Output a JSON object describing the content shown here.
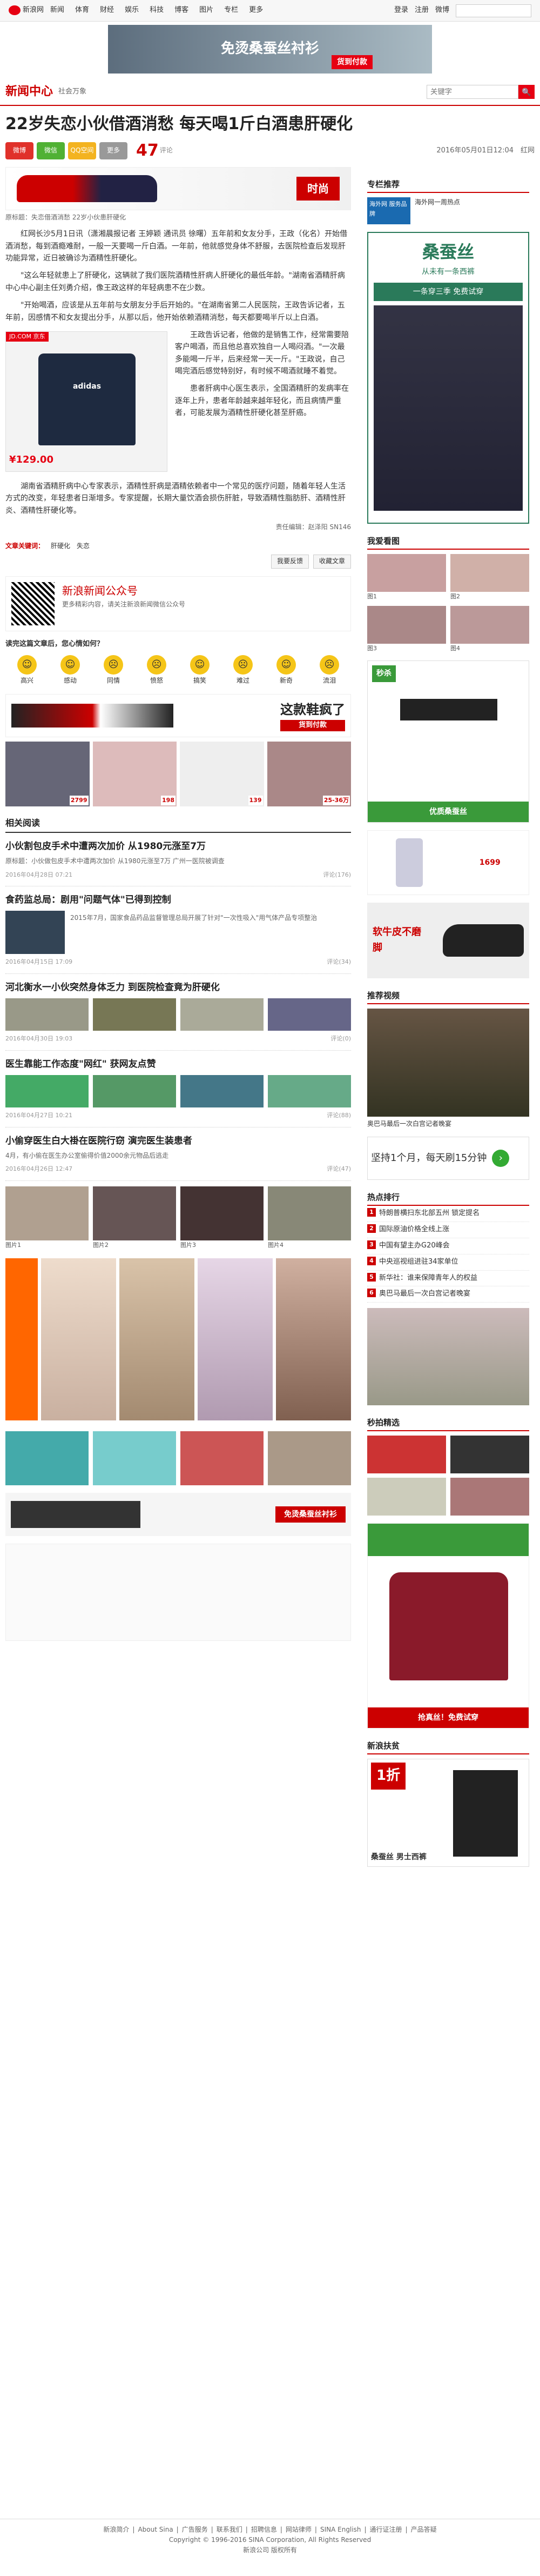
{
  "topbar": {
    "site": "新浪网",
    "nav": [
      "新闻",
      "体育",
      "财经",
      "娱乐",
      "科技",
      "博客",
      "图片",
      "专栏",
      "更多"
    ],
    "right": [
      "登录",
      "注册",
      "微博"
    ]
  },
  "top_banner": {
    "text": "免烫桑蚕丝衬衫",
    "button": "货到付款"
  },
  "channel": {
    "logo": "新闻中心",
    "sub": "社会万象",
    "search_placeholder": "关键字",
    "search_button": "🔍"
  },
  "title": "22岁失恋小伙借酒消愁 每天喝1斤白酒患肝硬化",
  "share": [
    "微博",
    "微信",
    "QQ空间",
    "更多"
  ],
  "comment_count": "47",
  "comment_label": "评论",
  "date_source": "2016年05月01日12:04　红网",
  "shoe_ad": {
    "title": "时尚",
    "btn": "货到付款"
  },
  "caption": "原标题：失恋借酒消愁 22岁小伙患肝硬化",
  "paragraphs": [
    "红网长沙5月1日讯（潇湘晨报记者 王婷颖 通讯员 徐曙）五年前和女友分手，王政（化名）开始借酒消愁，每到酒瘾难耐，一般一天要喝一斤白酒。一年前，他就感觉身体不舒服，去医院检查后发现肝功能异常，近日被确诊为酒精性肝硬化。",
    "\"这么年轻就患上了肝硬化，这辆就了我们医院酒精性肝病人肝硬化的最低年龄。\"湖南省酒精肝病中心中心副主任刘勇介绍，像王政这样的年轻病患不在少数。",
    "\"开始喝酒，应该是从五年前与女朋友分手后开始的。\"在湖南省第二人民医院，王政告诉记者，五年前，因感情不和女友提出分手，从那以后，他开始依赖酒精消愁，每天都要喝半斤以上白酒。",
    "王政告诉记者，他做的是销售工作，经常需要陪客户喝酒，而且他总喜欢独自一人喝闷酒。\"一次最多能喝一斤半，后来经常一天一斤。\"王政说，自己喝完酒后感觉特别好，有时候不喝酒就睡不着觉。",
    "患者肝病中心医生表示，全国酒精肝的发病率在逐年上升，患者年龄越来越年轻化，而且病情严重者，可能发展为酒精性肝硬化甚至肝癌。",
    "湖南省酒精肝病中心专家表示，酒精性肝病是酒精依赖者中一个常见的医疗问题，随着年轻人生活方式的改变，年轻患者日渐增多。专家提醒，长期大量饮酒会损伤肝脏，导致酒精性脂肪肝、酒精性肝炎、酒精性肝硬化等。"
  ],
  "shirt_ad": {
    "brand": "adidas",
    "price": "¥129.00",
    "tag": "JD.COM 京东"
  },
  "editor": "责任编辑：赵泽阳 SN146",
  "tags_label": "文章关键词：",
  "tags": [
    "肝硬化",
    "失恋"
  ],
  "action_buttons": [
    "我要反馈",
    "收藏文章"
  ],
  "wechat": {
    "title": "新浪新闻公众号",
    "desc": "更多精彩内容，请关注新浪新闻微信公众号"
  },
  "mood_title": "读完这篇文章后，您心情如何？",
  "moods": [
    "高兴",
    "感动",
    "同情",
    "愤怒",
    "搞笑",
    "难过",
    "新奇",
    "流泪"
  ],
  "mid_ad": {
    "text": "这款鞋疯了",
    "btn": "货到付款"
  },
  "prod_prices": [
    "2799",
    "198",
    "139",
    "25-36万"
  ],
  "related_title": "相关阅读",
  "related": [
    {
      "title": "小伙割包皮手术中遭两次加价 从1980元涨至7万",
      "sum": "原标题：小伙做包皮手术中遭两次加价 从1980元涨至7万 广州一医院被调查",
      "meta": "2016年04月28日 07:21",
      "comments": "评论(176)"
    },
    {
      "title": "食药监总局：剧用\"问题气体\"已得到控制",
      "sum": "2015年7月，国家食品药品监督管理总局开展了针对\"一次性吸入\"用气体产品专项整治",
      "meta": "2016年04月15日 17:09",
      "comments": "评论(34)"
    },
    {
      "title": "河北衡水一小伙突然身体乏力 到医院检查竟为肝硬化",
      "sum": "",
      "meta": "2016年04月30日 19:03",
      "comments": "评论(0)"
    },
    {
      "title": "医生靠能工作态度\"网红\" 获网友点赞",
      "sum": "",
      "meta": "2016年04月27日 10:21",
      "comments": "评论(88)"
    },
    {
      "title": "小偷穿医生白大褂在医院行窃 演完医生装患者",
      "sum": "4月，有小偷在医生办公室偷得价值2000余元物品后逃走",
      "meta": "2016年04月26日 12:47",
      "comments": "评论(47)"
    }
  ],
  "img_captions": [
    "图片1",
    "图片2",
    "图片3",
    "图片4"
  ],
  "side": {
    "rec_title": "专栏推荐",
    "rec_items": [
      "海外网 服务品牌",
      "海外网一周热点"
    ],
    "sangcansi": {
      "title": "桑蚕丝",
      "sub": "从未有一条西裤",
      "slogan": "一条穿三季 免费试穿"
    },
    "pic_title": "我爱看图",
    "pic_caps": [
      "图1",
      "图2",
      "图3",
      "图4"
    ],
    "belt_ad": {
      "title": "秒杀",
      "slogan": "优质桑蚕丝"
    },
    "phone_price": "1699",
    "shoe_ad": "软牛皮不磨脚",
    "video_title": "推荐视频",
    "video_cap": "奥巴马最后一次白宫记者晚宴",
    "stock_ad": "坚持1个月，每天刷15分钟",
    "hot_title": "热点排行",
    "hot": [
      "特朗普横扫东北部五州 锁定提名",
      "国际原油价格全线上涨",
      "中国有望主办G20峰会",
      "中央巡视组进驻34家单位",
      "新华社：谁来保障青年人的权益",
      "奥巴马最后一次白宫记者晚宴"
    ],
    "second_title": "秒拍精选",
    "bottom_ad": {
      "slogan": "抢真丝！免费试穿"
    },
    "xinlang_title": "新浪扶贫",
    "mulberry": "桑蚕丝 男士西裤"
  },
  "footer": {
    "links": [
      "新浪简介",
      "About Sina",
      "广告服务",
      "联系我们",
      "招聘信息",
      "网站律师",
      "SINA English",
      "通行证注册",
      "产品答疑"
    ],
    "copy": "Copyright © 1996-2016 SINA Corporation, All Rights Reserved",
    "company": "新浪公司 版权所有"
  }
}
